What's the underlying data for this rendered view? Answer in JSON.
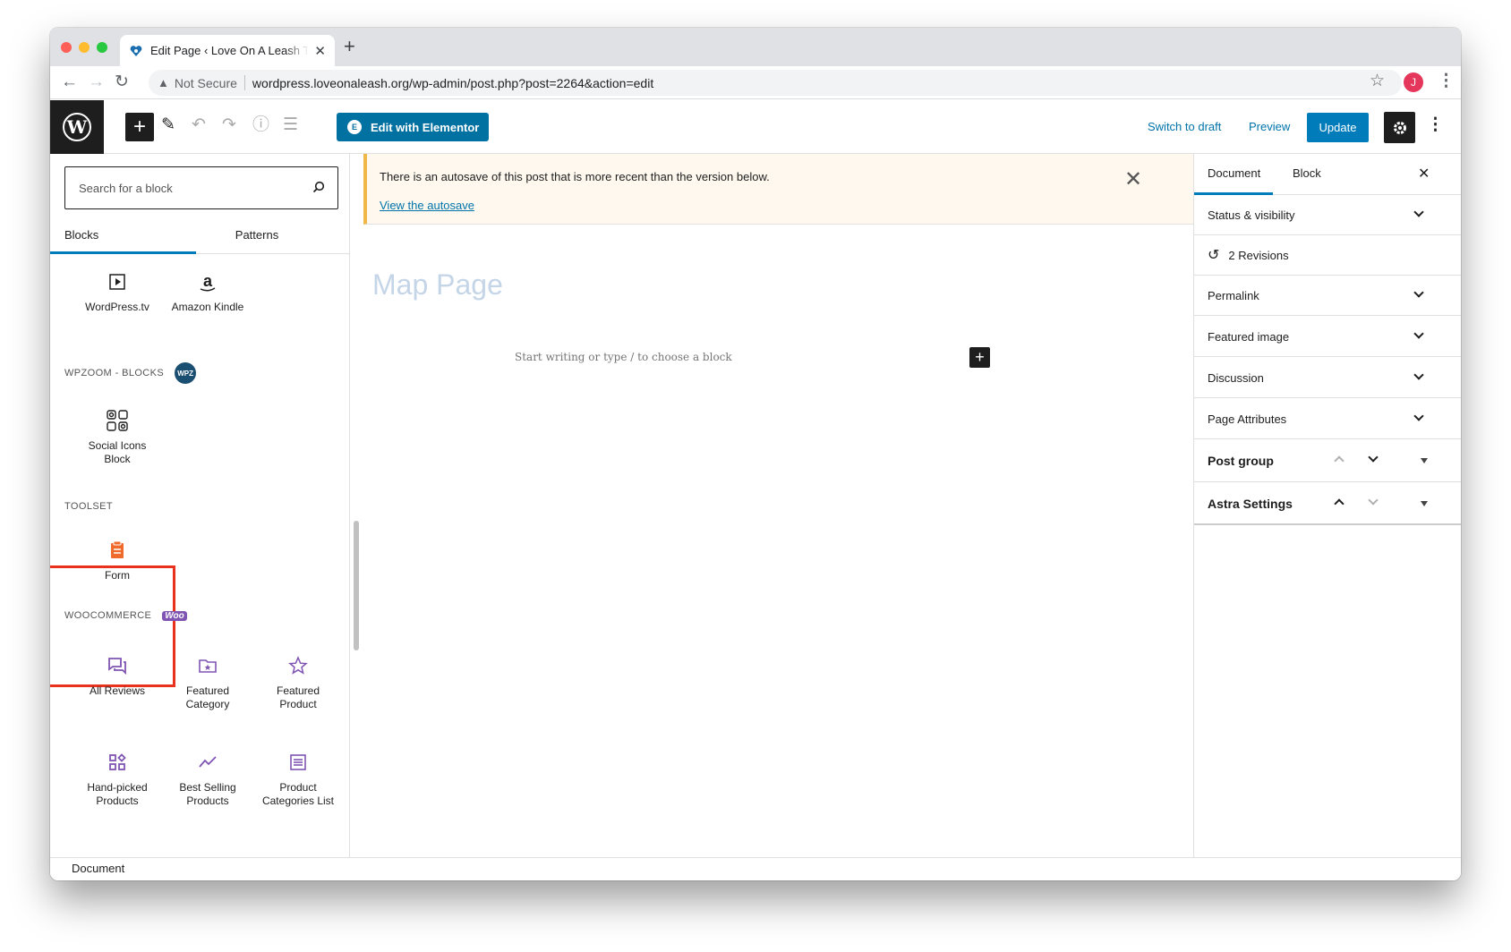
{
  "browser": {
    "tab_title": "Edit Page ‹ Love On A Leash Therapy Dogs",
    "new_tab": "+",
    "security_label": "Not Secure",
    "url": "wordpress.loveonaleash.org/wp-admin/post.php?post=2264&action=edit",
    "profile_initial": "J",
    "traffic_colors": [
      "#fe5f57",
      "#febc2e",
      "#28c840"
    ]
  },
  "toolbar": {
    "elementor_label": "Edit with Elementor",
    "elementor_badge": "E",
    "switch_draft_label": "Switch to draft",
    "preview_label": "Preview",
    "update_label": "Update"
  },
  "inserter": {
    "search_placeholder": "Search for a block",
    "tabs": [
      "Blocks",
      "Patterns"
    ],
    "embeds": [
      {
        "label": "WordPress.tv",
        "icon": "play-icon"
      },
      {
        "label": "Amazon Kindle",
        "icon": "amazon-icon"
      }
    ],
    "wpzoom_category": "WPZOOM - BLOCKS",
    "wpzoom_badge": "WPZ",
    "wpzoom_blocks": [
      {
        "label": "Social Icons Block",
        "icon": "social-icons-icon"
      }
    ],
    "toolset_category": "TOOLSET",
    "toolset_blocks": [
      {
        "label": "Form",
        "icon": "form-icon"
      }
    ],
    "woo_category": "WOOCOMMERCE",
    "woo_badge": "Woo",
    "woo_blocks": [
      {
        "label": "All Reviews",
        "icon": "reviews-icon"
      },
      {
        "label": "Featured Category",
        "icon": "folder-star-icon"
      },
      {
        "label": "Featured Product",
        "icon": "star-icon"
      },
      {
        "label": "Hand-picked Products",
        "icon": "grid-icon"
      },
      {
        "label": "Best Selling Products",
        "icon": "trend-icon"
      },
      {
        "label": "Product Categories List",
        "icon": "list-icon"
      }
    ],
    "accent": "#7f54b3"
  },
  "editor": {
    "notice_text": "There is an autosave of this post that is more recent than the version below.",
    "notice_link": "View the autosave",
    "page_title": "Map Page",
    "placeholder": "Start writing or type / to choose a block"
  },
  "sidebar": {
    "tabs": [
      "Document",
      "Block"
    ],
    "panels": {
      "status": "Status & visibility",
      "revisions": "2 Revisions",
      "permalink": "Permalink",
      "featured": "Featured image",
      "discussion": "Discussion",
      "attributes": "Page Attributes",
      "post_group": "Post group",
      "astra": "Astra Settings"
    }
  },
  "footer": {
    "breadcrumb": "Document"
  }
}
